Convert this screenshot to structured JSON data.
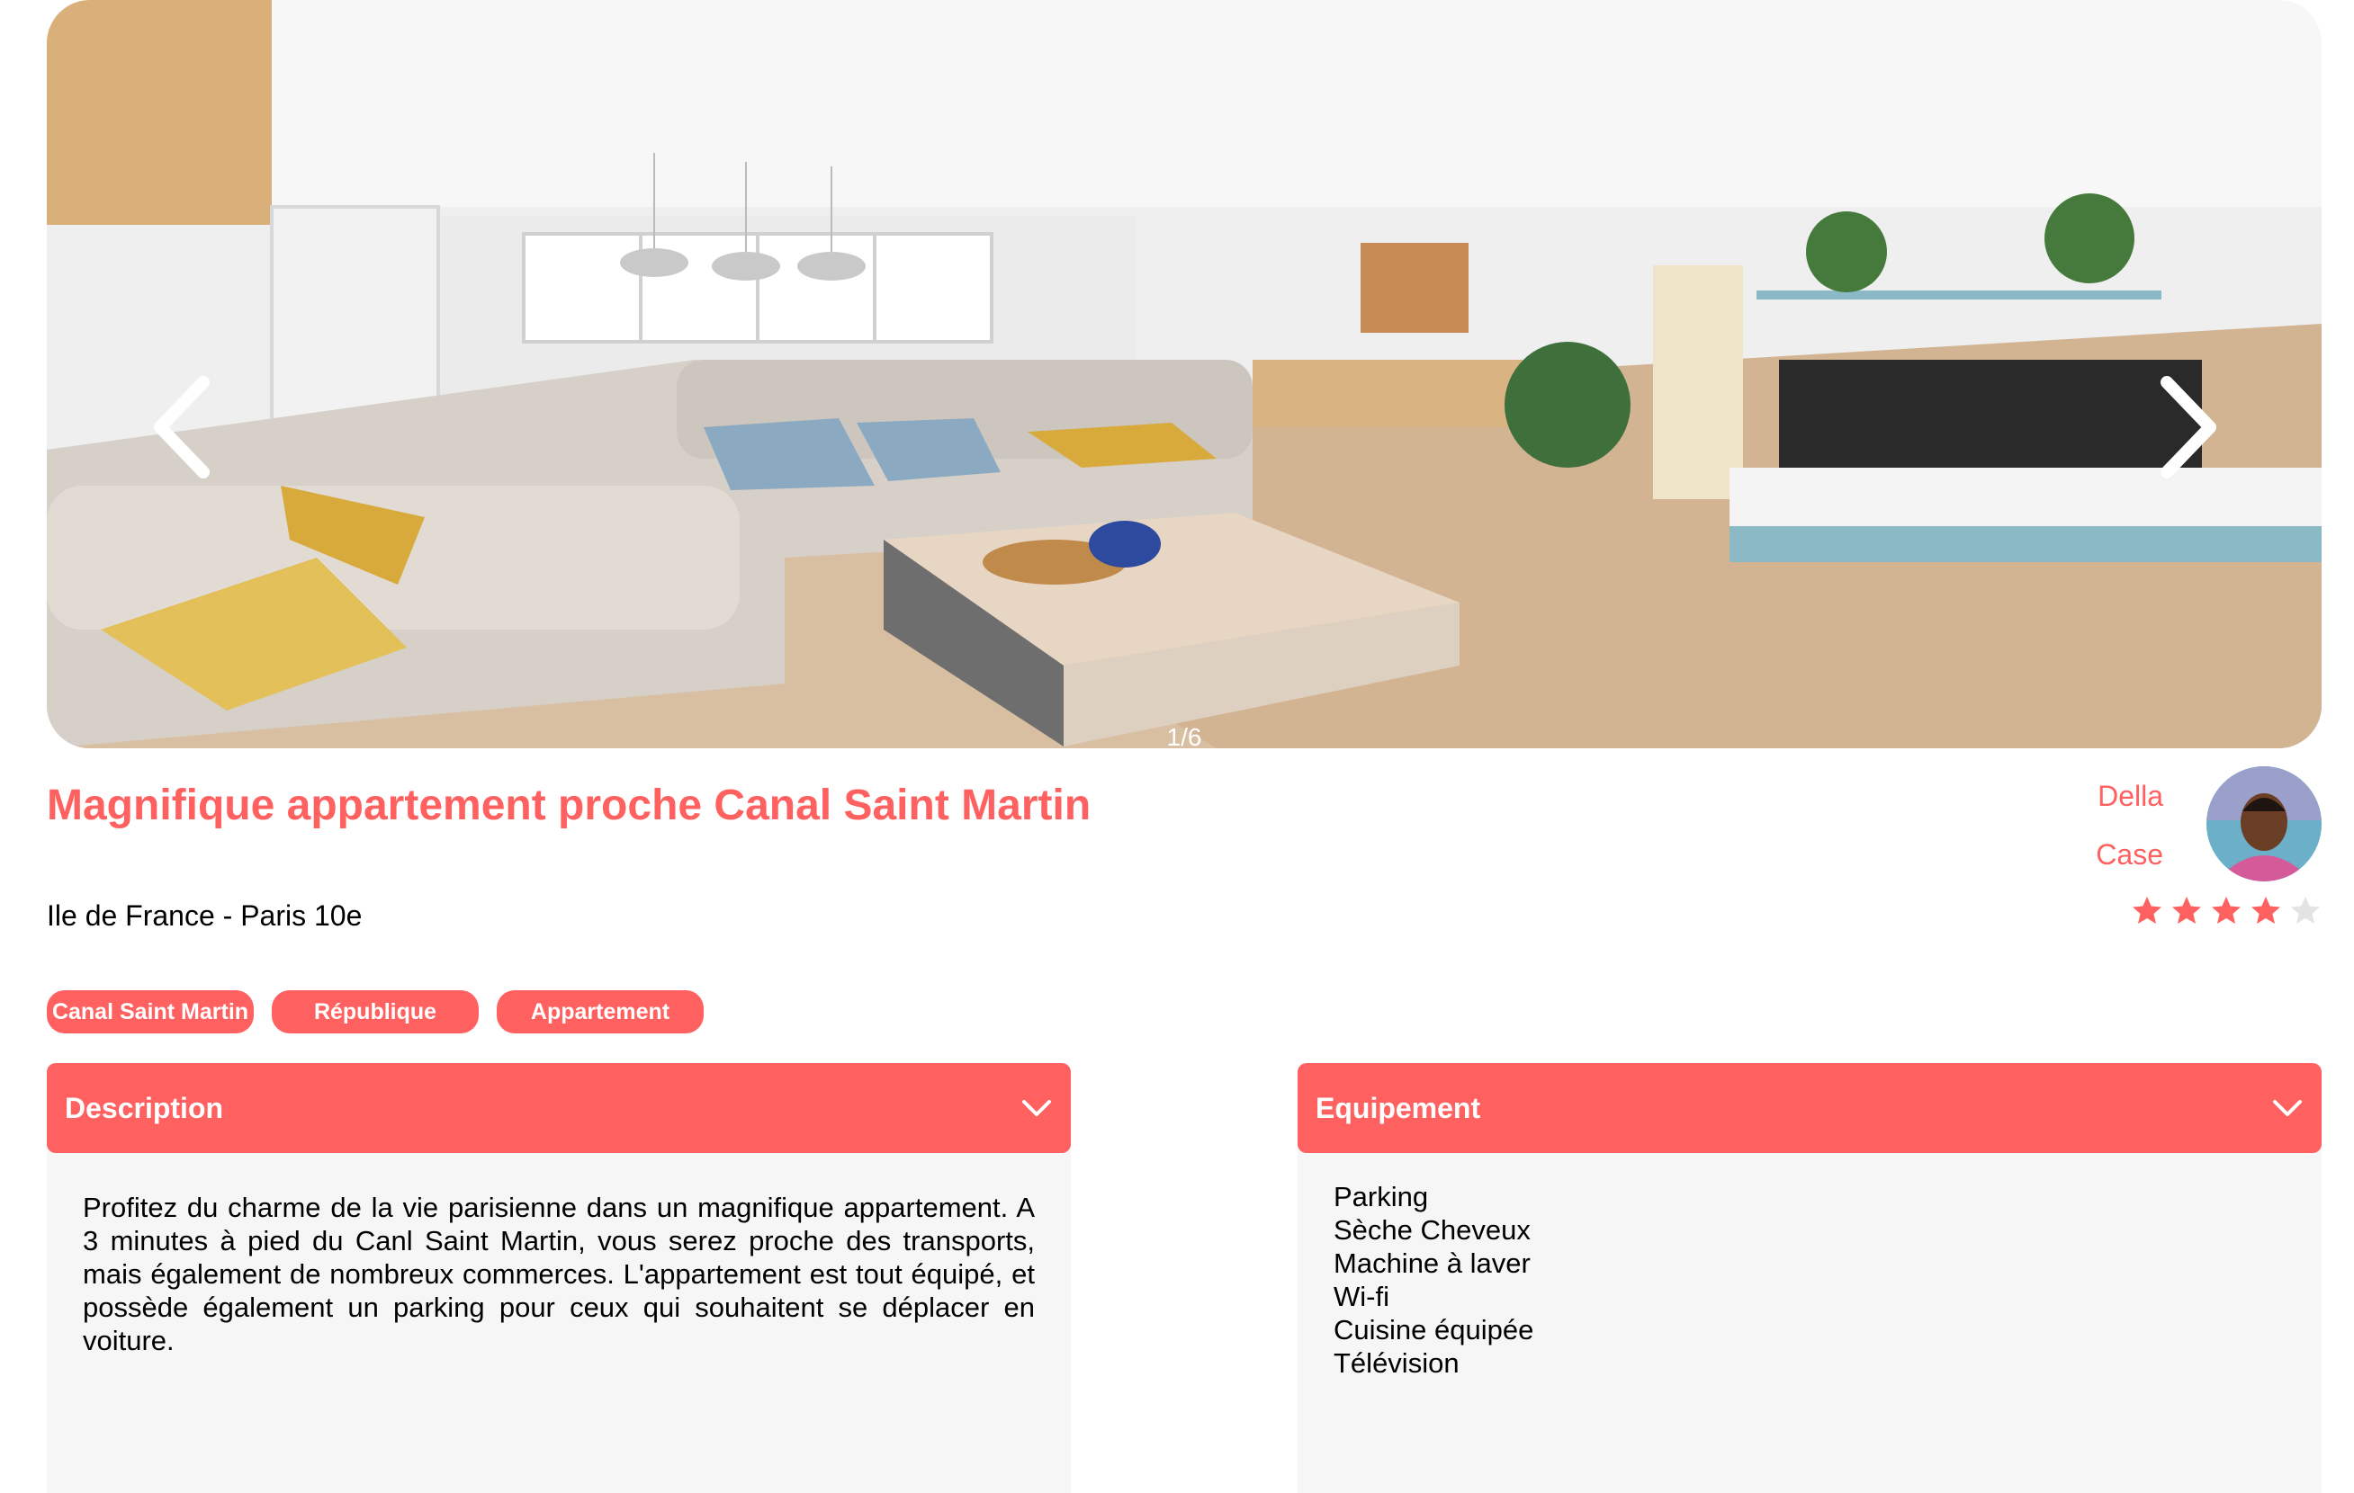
{
  "carousel": {
    "counter": "1/6",
    "prev_icon": "chevron-left-icon",
    "next_icon": "chevron-right-icon"
  },
  "listing": {
    "title": "Magnifique appartement proche Canal Saint Martin",
    "location": "Ile de France - Paris 10e",
    "tags": [
      "Canal Saint Martin",
      "République",
      "Appartement"
    ]
  },
  "host": {
    "first_name": "Della",
    "last_name": "Case",
    "rating": 4,
    "rating_max": 5
  },
  "description": {
    "title": "Description",
    "text": "Profitez du charme de la vie parisienne dans un magnifique appartement. A 3 minutes à pied du Canl Saint Martin, vous serez proche des transports, mais également de nombreux commerces. L'appartement est tout équipé, et possède également un parking pour ceux qui souhaitent se déplacer en voiture."
  },
  "equipment": {
    "title": "Equipement",
    "items": [
      "Parking",
      "Sèche Cheveux",
      "Machine à laver",
      "Wi-fi",
      "Cuisine équipée",
      "Télévision"
    ]
  },
  "colors": {
    "accent": "#ff6060",
    "panel_bg": "#f6f6f6",
    "star_filled": "#ff6060",
    "star_empty": "#e3e3e3"
  }
}
